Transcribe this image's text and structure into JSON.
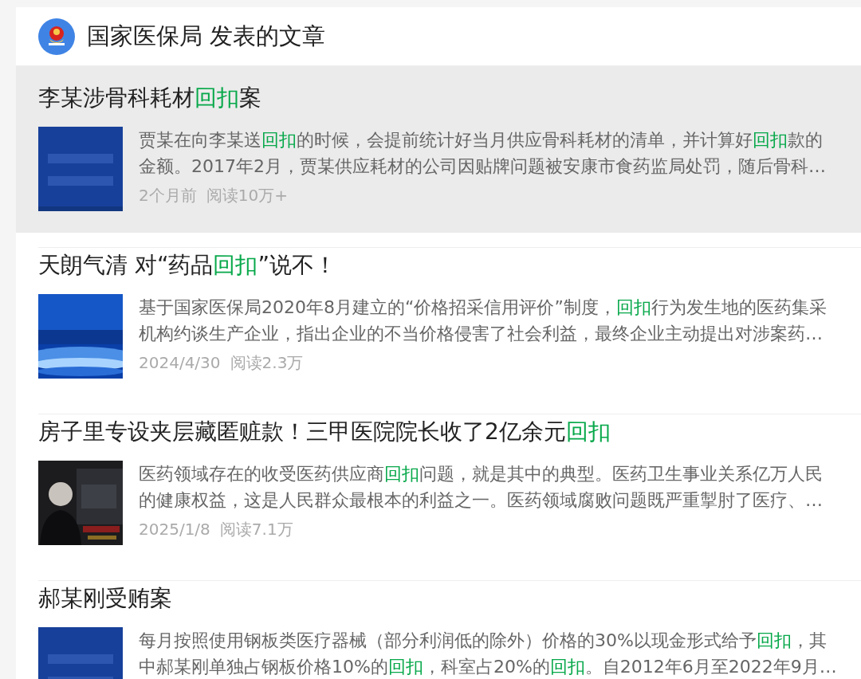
{
  "header": {
    "title": "国家医保局 发表的文章"
  },
  "articles": [
    {
      "selected": true,
      "title": [
        {
          "text": "李某涉骨科耗材",
          "highlighted": false
        },
        {
          "text": "回扣",
          "highlighted": true
        },
        {
          "text": "案",
          "highlighted": false
        }
      ],
      "summary_lines": [
        [
          {
            "text": "贾某在向李某送",
            "highlighted": false
          },
          {
            "text": "回扣",
            "highlighted": true
          },
          {
            "text": "的时候，会提前统计好当月供应骨科耗材的清单，并计算好",
            "highlighted": false
          },
          {
            "text": "回扣",
            "highlighted": true
          },
          {
            "text": "款的",
            "highlighted": false
          }
        ],
        [
          {
            "text": "金额。2017年2月，贾某供应耗材的公司因贴牌问题被安康市食药监局处罚，随后骨科…",
            "highlighted": false
          }
        ]
      ],
      "date": "2个月前",
      "reads": "阅读10万+"
    },
    {
      "selected": false,
      "title": [
        {
          "text": "天朗气清 对“药品",
          "highlighted": false
        },
        {
          "text": "回扣",
          "highlighted": true
        },
        {
          "text": "”说不！",
          "highlighted": false
        }
      ],
      "summary_lines": [
        [
          {
            "text": "基于国家医保局2020年8月建立的“价格招采信用评价”制度，",
            "highlighted": false
          },
          {
            "text": "回扣",
            "highlighted": true
          },
          {
            "text": "行为发生地的医药集采",
            "highlighted": false
          }
        ],
        [
          {
            "text": "机构约谈生产企业，指出企业的不当价格侵害了社会利益，最终企业主动提出对涉案药…",
            "highlighted": false
          }
        ]
      ],
      "date": "2024/4/30",
      "reads": "阅读2.3万"
    },
    {
      "selected": false,
      "title": [
        {
          "text": "房子里专设夹层藏匿赃款！三甲医院院长收了2亿余元",
          "highlighted": false
        },
        {
          "text": "回扣",
          "highlighted": true
        }
      ],
      "summary_lines": [
        [
          {
            "text": "医药领域存在的收受医药供应商",
            "highlighted": false
          },
          {
            "text": "回扣",
            "highlighted": true
          },
          {
            "text": "问题，就是其中的典型。医药卫生事业关系亿万人民",
            "highlighted": false
          }
        ],
        [
          {
            "text": "的健康权益，这是人民群众最根本的利益之一。医药领域腐败问题既严重掣肘了医疗、…",
            "highlighted": false
          }
        ]
      ],
      "date": "2025/1/8",
      "reads": "阅读7.1万"
    },
    {
      "selected": false,
      "title": [
        {
          "text": "郝某刚受贿案",
          "highlighted": false
        }
      ],
      "summary_lines": [
        [
          {
            "text": "每月按照使用钢板类医疗器械（部分利润低的除外）价格的30%以现金形式给予",
            "highlighted": false
          },
          {
            "text": "回扣",
            "highlighted": true
          },
          {
            "text": "，其",
            "highlighted": false
          }
        ],
        [
          {
            "text": "中郝某刚单独占钢板价格10%的",
            "highlighted": false
          },
          {
            "text": "回扣",
            "highlighted": true
          },
          {
            "text": "，科室占20%的",
            "highlighted": false
          },
          {
            "text": "回扣",
            "highlighted": true
          },
          {
            "text": "。自2012年6月至2022年9月…",
            "highlighted": false
          }
        ]
      ]
    }
  ]
}
